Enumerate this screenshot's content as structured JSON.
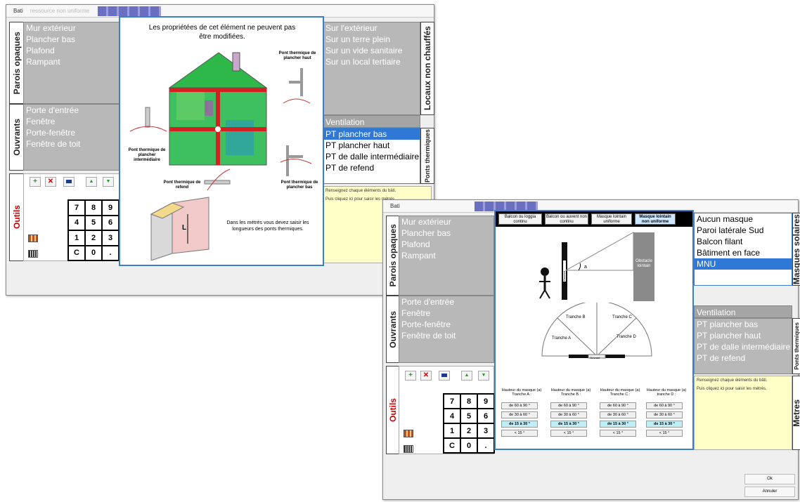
{
  "window1": {
    "title": "Bati",
    "title_sub": "ressource non uniforme",
    "tabs": {
      "opaque": "Parois opaques",
      "openings": "Ouvrants",
      "tools": "Outils",
      "unheated": "Locaux non chauffés",
      "thermal": "Ponts thermiques"
    },
    "opaque_items": [
      "Mur extérieur",
      "Plancher bas",
      "Plafond",
      "Rampant"
    ],
    "opening_items": [
      "Porte d'entrée",
      "Fenêtre",
      "Porte-fenêtre",
      "Fenêtre de toit"
    ],
    "unheated_items": [
      "Sur l'extérieur",
      "Sur un terre plein",
      "Sur un vide sanitaire",
      "Sur un local tertiaire"
    ],
    "ventilation": "Ventilation",
    "thermal_items": [
      "PT plancher bas",
      "PT plancher haut",
      "PT de dalle intermédiaire",
      "PT de refend"
    ],
    "thermal_selected": 0,
    "help_lines": [
      "Renseignez chaque éléments du bâti.",
      "Puis cliquez ici pour saisir les métrés."
    ],
    "popup": {
      "heading": "Les propriétées de cet élément ne peuvent pas être modifiées.",
      "labels": {
        "haut": "Pont thermique de plancher haut",
        "intermediaire": "Pont thermique de plancher intermédiaire",
        "refend": "Pont thermique de refend",
        "bas": "Pont thermique de plancher bas"
      },
      "L": "L",
      "note": "Dans les métrés vous devez saisir les longueurs des ponts thermiques."
    }
  },
  "keypad": [
    "7",
    "8",
    "9",
    "4",
    "5",
    "6",
    "1",
    "2",
    "3",
    "C",
    "0",
    "."
  ],
  "toolbar": {
    "add": "+",
    "remove": "✕",
    "up": "▲",
    "down": "▼"
  },
  "window2": {
    "title": "Bati",
    "tabs": {
      "opaque": "Parois opaques",
      "openings": "Ouvrants",
      "tools": "Outils",
      "masks": "Masques solaires",
      "thermal": "Ponts thermiques",
      "metres": "Metres"
    },
    "opaque_items": [
      "Mur extérieur",
      "Plancher bas",
      "Plafond",
      "Rampant"
    ],
    "opening_items": [
      "Porte d'entrée",
      "Fenêtre",
      "Porte-fenêtre",
      "Fenêtre de toit"
    ],
    "mask_items": [
      "Aucun masque",
      "Paroi latérale Sud",
      "Balcon filant",
      "Bâtiment en face",
      "MNU"
    ],
    "mask_selected": 4,
    "ventilation": "Ventilation",
    "thermal_items": [
      "PT plancher bas",
      "PT plancher haut",
      "PT de dalle intermédiaire",
      "PT de refend"
    ],
    "help_lines": [
      "Renseignez chaque éléments du bâti.",
      "Puis cliquez ici pour saisir les métrés."
    ],
    "ok": "Ok",
    "cancel": "Annuler",
    "popup": {
      "tabs": [
        "Balcon ou loggia continu",
        "Balcon ou auvent non continu",
        "Masque lointain uniforme",
        "Masque lointain non uniforme"
      ],
      "active_tab": 3,
      "ouvrant": "Ouvrant",
      "angle": "a",
      "obstacle": "Obstacle lointain",
      "tranches": [
        "Tranche B",
        "Tranche C",
        "Tranche A",
        "Tranche D"
      ],
      "ouvrant_bottom": "Ouvrant",
      "columns": [
        {
          "label": "Hauteur du masque (a) Tranche A :",
          "options": [
            "de 60 à 90 °",
            "de 30 à 60 °",
            "de 15 à 30 °",
            "< 15 °"
          ],
          "selected": 2
        },
        {
          "label": "Hauteur du masque (a) Tranche B :",
          "options": [
            "de 60 à 90 °",
            "de 30 à 60 °",
            "de 15 à 30 °",
            "< 15 °"
          ],
          "selected": 2
        },
        {
          "label": "Hauteur du masque (a) Tranche C :",
          "options": [
            "de 60 à 90 °",
            "de 30 à 60 °",
            "de 15 à 30 °",
            "< 15 °"
          ],
          "selected": 2
        },
        {
          "label": "Hauteur du masque (a) tranche D :",
          "options": [
            "de 60 à 90 °",
            "de 30 à 60 °",
            "de 15 à 30 °",
            "< 15 °"
          ],
          "selected": 2
        }
      ]
    }
  }
}
